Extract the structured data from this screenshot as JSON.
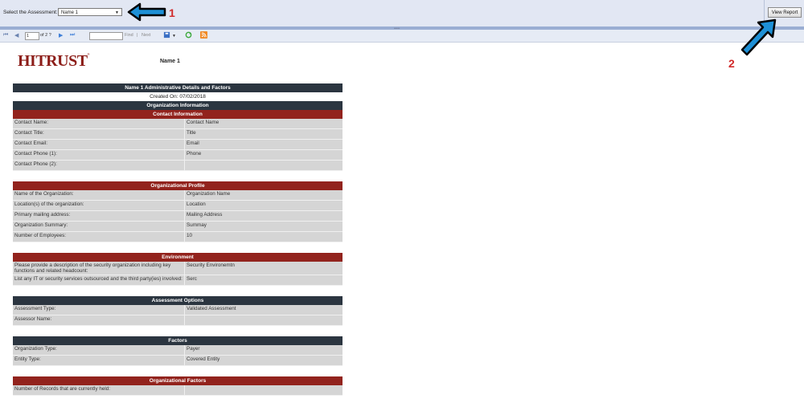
{
  "params": {
    "label": "Select the Assessment:",
    "selected": "Name 1",
    "view_report": "View Report"
  },
  "toolbar": {
    "page": "1",
    "of_text": "of 2 ?",
    "find": "Find",
    "sep": "|",
    "next": "Next"
  },
  "report": {
    "logo": "HITRUST",
    "name": "Name 1",
    "title": "Name 1 Administrative Details and Factors",
    "created": "Created On: 07/02/2018",
    "org_info": "Organization Information",
    "contact": {
      "header": "Contact Information",
      "rows": [
        [
          "Contact Name:",
          "Contact Name"
        ],
        [
          "Contact Title:",
          "Title"
        ],
        [
          "Contact Email:",
          "Email"
        ],
        [
          "Contact Phone (1):",
          "Phone"
        ],
        [
          "Contact Phone (2):",
          ""
        ]
      ]
    },
    "profile": {
      "header": "Organizational Profile",
      "rows": [
        [
          "Name of the Organization:",
          "Organization Name"
        ],
        [
          "Location(s) of the organization:",
          "Location"
        ],
        [
          "Primary mailing address:",
          "Mailing Address"
        ],
        [
          "Organization Summary:",
          "Summay"
        ],
        [
          "Number of Employees:",
          "10"
        ]
      ]
    },
    "environment": {
      "header": "Environment",
      "rows": [
        [
          "Please provide a description of the security organization including key functions and related headcount:",
          "Security Environemtn"
        ],
        [
          "List any IT or security services outsourced and the third party(ies) involved:",
          "Serc"
        ]
      ]
    },
    "assessment": {
      "header": "Assessment Options",
      "rows": [
        [
          "Assessment Type:",
          "Validated Assessment"
        ],
        [
          "Assessor Name:",
          ""
        ]
      ]
    },
    "factors": {
      "header": "Factors",
      "rows": [
        [
          "Organization Type:",
          "Payer"
        ],
        [
          "Entity Type:",
          "Covered Entity"
        ]
      ]
    },
    "org_factors": {
      "header": "Organizational Factors",
      "rows": [
        [
          "Number of Records that are currently held:",
          ""
        ]
      ]
    }
  },
  "annotations": {
    "one": "1",
    "two": "2"
  },
  "colors": {
    "header_dark": "#2b3540",
    "header_red": "#92231d",
    "arrow_fill": "#1e90d6",
    "annotation": "#d12a2a"
  }
}
